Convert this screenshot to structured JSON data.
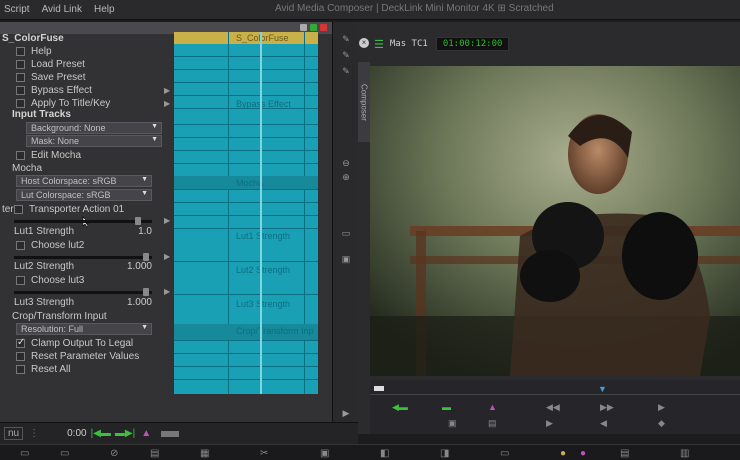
{
  "menubar": {
    "items": [
      "Script",
      "Avid Link",
      "Help"
    ],
    "app_title": "Avid Media Composer | DeckLink Mini Monitor 4K ⊞ Scratched"
  },
  "effect": {
    "name": "S_ColorFuse",
    "rows": {
      "header": "S_ColorFuse",
      "help": "Help",
      "load_preset": "Load Preset",
      "save_preset": "Save Preset",
      "bypass_effect": "Bypass Effect",
      "apply_title": "Apply To Title/Key",
      "input_tracks": "Input Tracks",
      "background": "Background: None",
      "mask": "Mask: None",
      "edit_mocha": "Edit Mocha",
      "mocha": "Mocha",
      "host_colorspace": "Host Colorspace: sRGB",
      "lut_colorspace": "Lut Colorspace: sRGB",
      "transporter_prefix": "ter",
      "transporter": "Transporter Action 01",
      "lut1_strength": "Lut1 Strength",
      "lut1_value": "1.0",
      "choose_lut2": "Choose lut2",
      "lut2_strength": "Lut2 Strength",
      "lut2_value": "1.000",
      "choose_lut3": "Choose lut3",
      "lut3_strength": "Lut3 Strength",
      "lut3_value": "1.000",
      "crop_input": "Crop/Transform Input",
      "resolution": "Resolution: Full",
      "clamp": "Clamp Output To Legal",
      "reset_params": "Reset Parameter Values",
      "reset_all": "Reset All"
    },
    "track_labels": {
      "top": "S_ColorFuse",
      "bypass": "Bypass Effect",
      "mocha": "Mocha",
      "lut1": "Lut1 Strength",
      "lut2": "Lut2 Strength",
      "lut3": "Lut3 Strength",
      "crop": "Crop/Transform Inp"
    },
    "clamp_checked": true,
    "slider_levels": {
      "lut1": 0.92,
      "lut2": 0.98,
      "lut3": 0.98
    }
  },
  "composer": {
    "tab_label": "Composer",
    "monitor_name": "Mas TC1",
    "timecode": "01:00:12:00"
  },
  "bottom": {
    "time": "0:00",
    "nav_label": "nu"
  },
  "colors": {
    "track": "#1aa0b4",
    "track_header": "#c9b048",
    "timecode_green": "#2fb82f",
    "panel_bg": "#323234"
  }
}
